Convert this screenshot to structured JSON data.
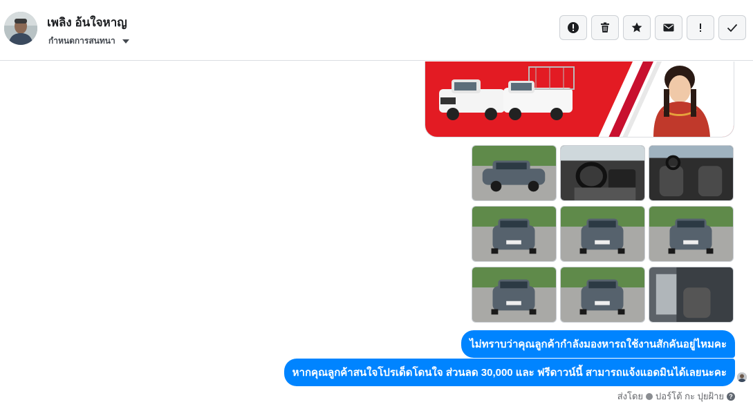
{
  "header": {
    "contact_name": "เพลิง อ้นใจหาญ",
    "assign_label": "กำหนดการสนทนา",
    "actions": [
      {
        "icon": "spam-alert-icon"
      },
      {
        "icon": "trash-icon"
      },
      {
        "icon": "star-icon"
      },
      {
        "icon": "envelope-icon"
      },
      {
        "icon": "exclamation-icon"
      },
      {
        "icon": "check-icon"
      }
    ]
  },
  "messages": [
    "ไม่ทราบว่าคุณลูกค้ากำลังมองหารถใช้งานสักคันอยู่ไหมคะ",
    "หากคุณลูกค้าสนใจโปรเด็ดโดนใจ  ส่วนลด 30,000 และ ฟรีดาวน์นี้ สามารถแจ้งแอดมินได้เลยนะคะ"
  ],
  "footer": {
    "sent_by": "ส่งโดย",
    "sender_name": "ปอร์โต้ กะ ปุยฝ้าย",
    "help_glyph": "?"
  },
  "colors": {
    "bubble": "#0084ff",
    "banner_red": "#e31b23"
  }
}
